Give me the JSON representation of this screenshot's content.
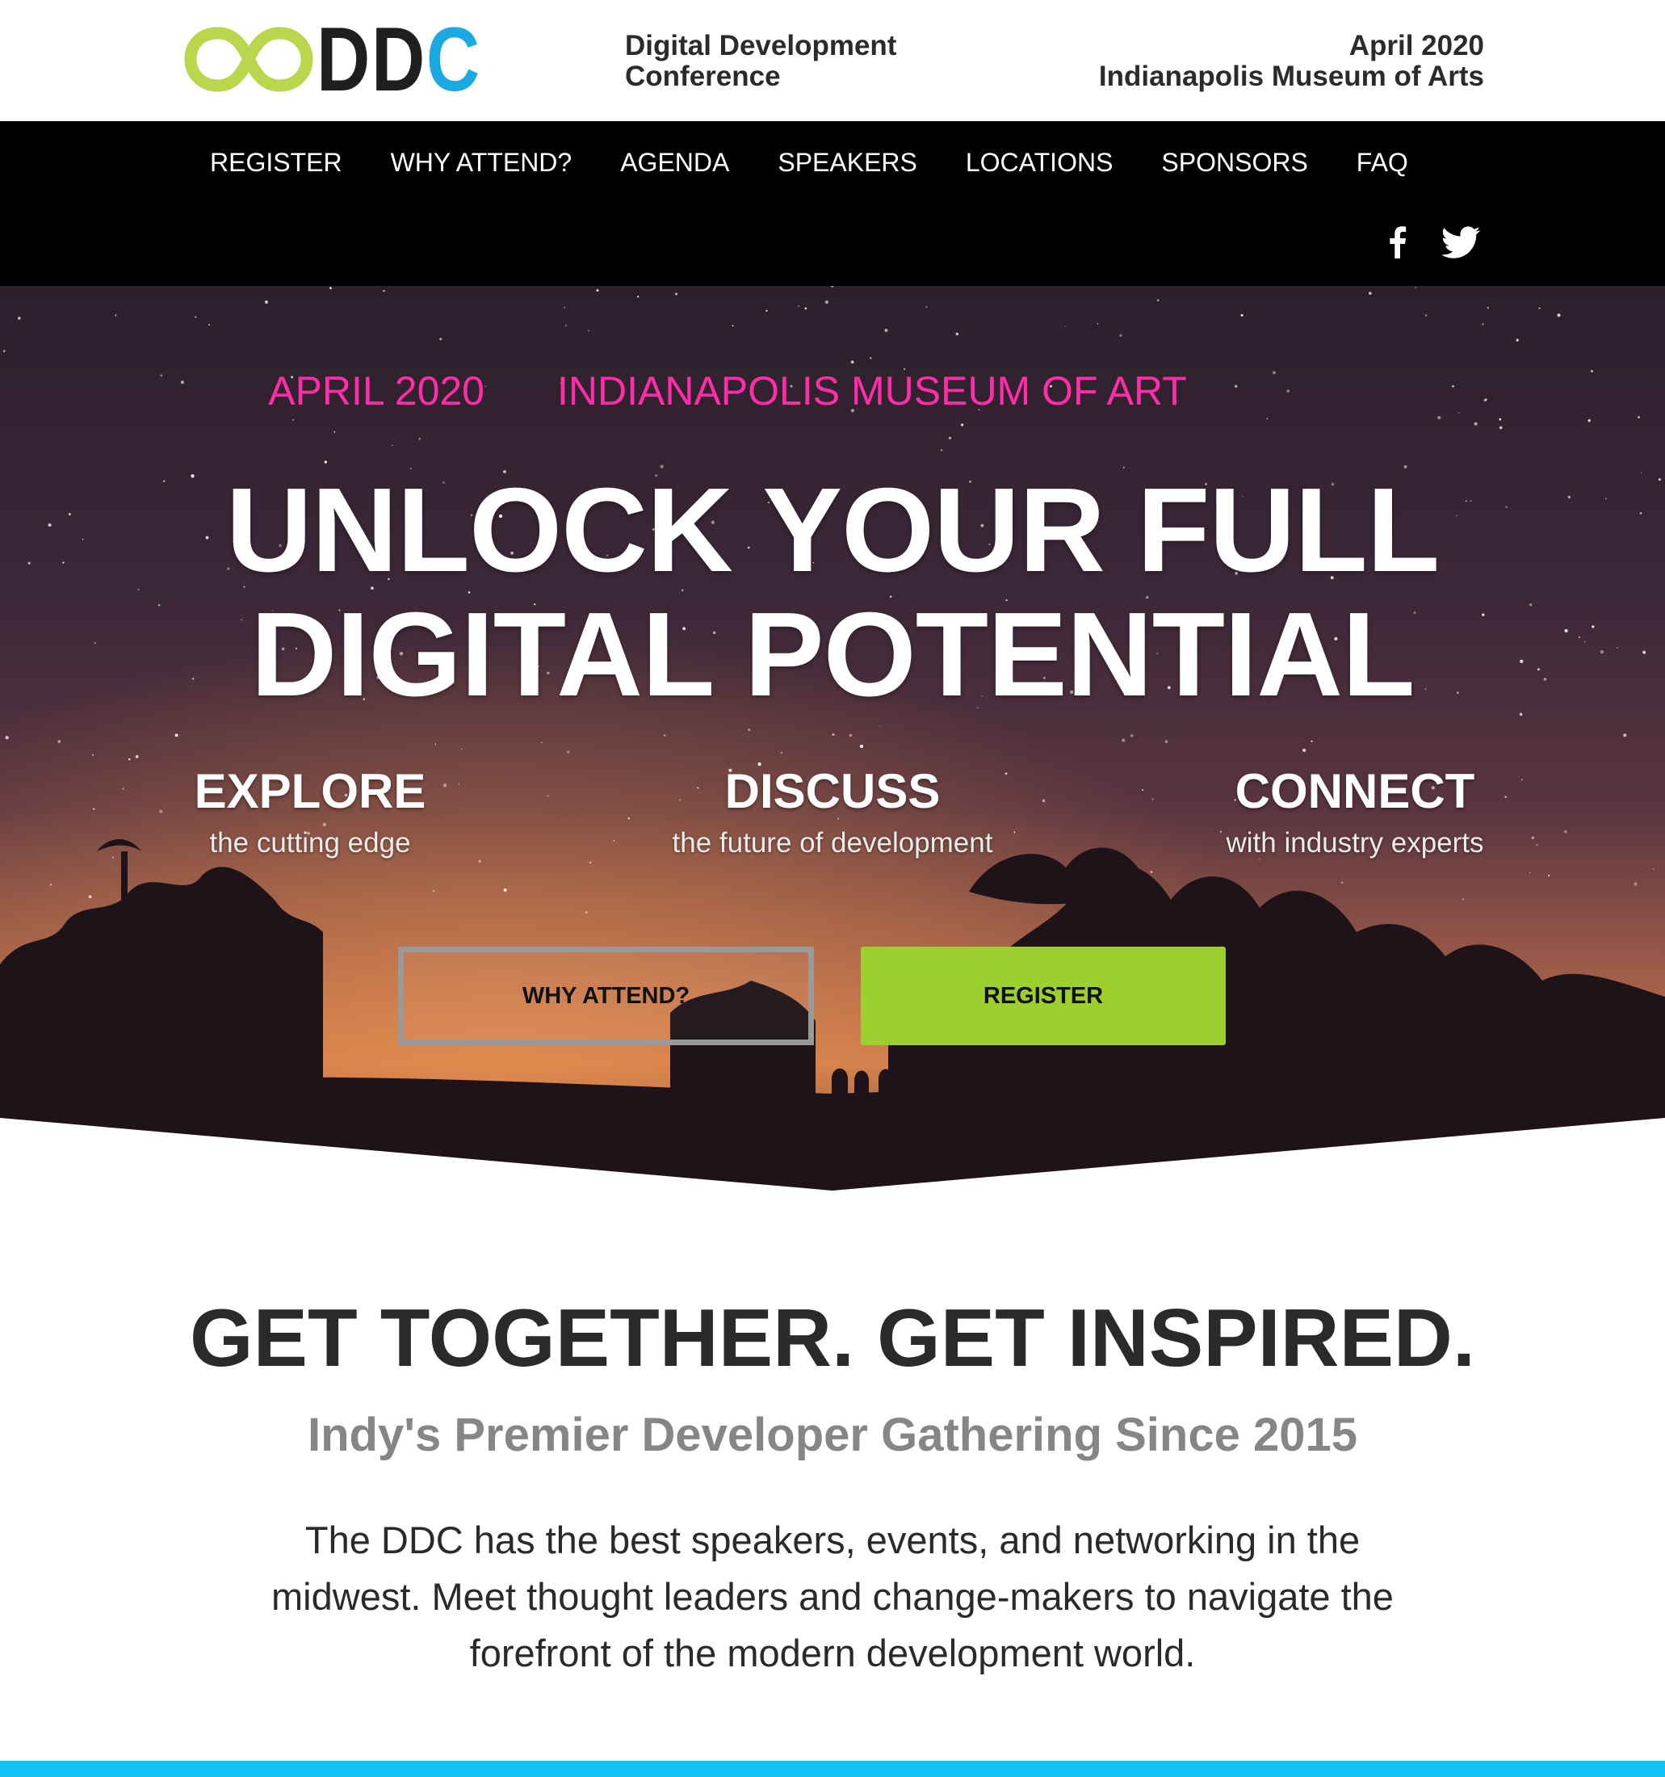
{
  "brand": {
    "logo_text_dd": "DD",
    "logo_text_c": "C",
    "logo_icon": "infinity-icon",
    "colors": {
      "logo_green": "#b9d64c",
      "logo_dark": "#1f1f1f",
      "logo_blue": "#1aa9e0"
    }
  },
  "header": {
    "conference_name_line1": "Digital Development",
    "conference_name_line2": "Conference",
    "date_line": "April 2020",
    "venue_line": "Indianapolis Museum of Arts"
  },
  "nav": {
    "items": [
      {
        "label": "REGISTER"
      },
      {
        "label": "WHY ATTEND?"
      },
      {
        "label": "AGENDA"
      },
      {
        "label": "SPEAKERS"
      },
      {
        "label": "LOCATIONS"
      },
      {
        "label": "SPONSORS"
      },
      {
        "label": "FAQ"
      }
    ],
    "social": [
      {
        "icon": "facebook-icon"
      },
      {
        "icon": "twitter-icon"
      }
    ]
  },
  "hero": {
    "date": "APRIL 2020",
    "venue": "INDIANAPOLIS MUSEUM OF ART",
    "title_line1": "UNLOCK YOUR FULL",
    "title_line2": "DIGITAL POTENTIAL",
    "pillars": [
      {
        "title": "EXPLORE",
        "subtitle": "the cutting edge"
      },
      {
        "title": "DISCUSS",
        "subtitle": "the future of development"
      },
      {
        "title": "CONNECT",
        "subtitle": "with industry experts"
      }
    ],
    "buttons": {
      "why_attend": "WHY ATTEND?",
      "register": "REGISTER"
    },
    "colors": {
      "accent_pink": "#ff2ea8",
      "register_green": "#9dcf2e"
    }
  },
  "about": {
    "title": "GET TOGETHER. GET INSPIRED.",
    "subtitle": "Indy's Premier Developer Gathering Since 2015",
    "body": "The DDC has the best speakers, events, and networking in the midwest. Meet thought leaders and change-makers to navigate the forefront of the modern development world."
  }
}
